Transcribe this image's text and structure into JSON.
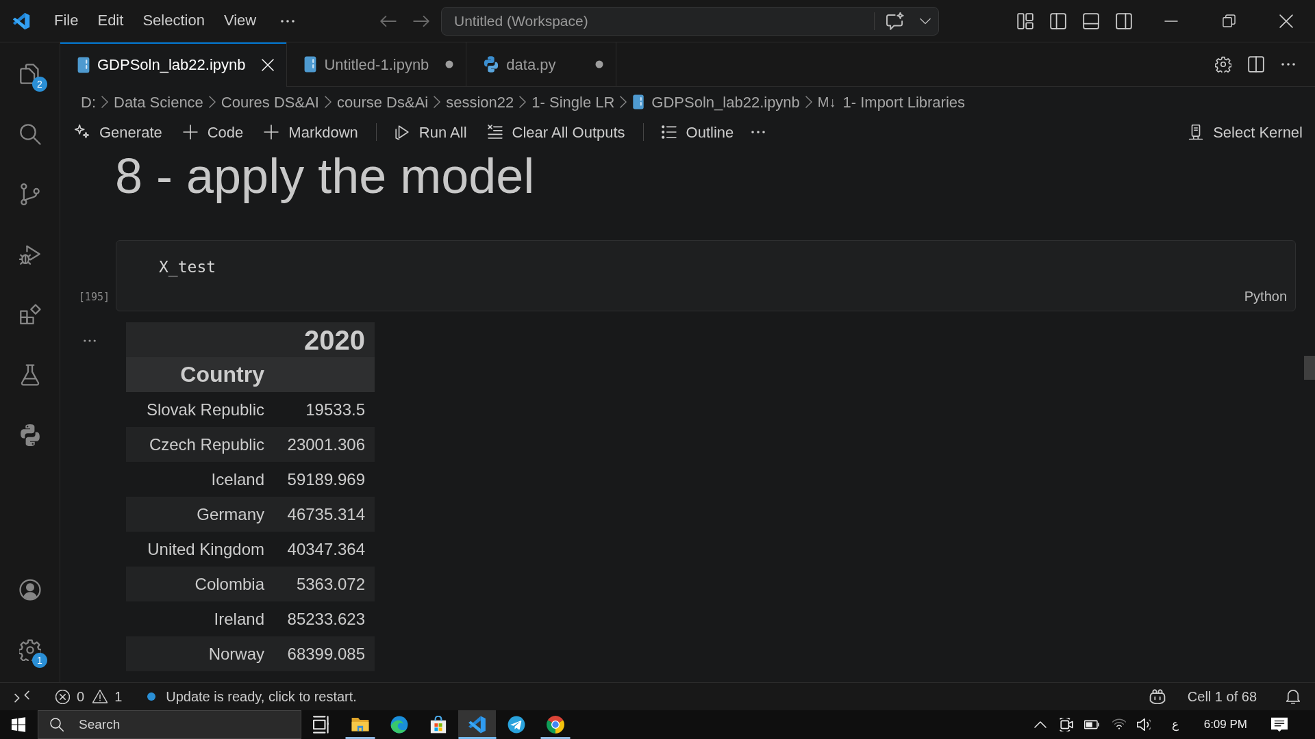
{
  "title_bar": {
    "menu": [
      "File",
      "Edit",
      "Selection",
      "View"
    ],
    "command_center": "Untitled (Workspace)"
  },
  "activity_bar": {
    "items": [
      {
        "kind": "explorer",
        "badge": "2",
        "selected": false
      },
      {
        "kind": "search",
        "selected": false
      },
      {
        "kind": "source-control",
        "selected": false
      },
      {
        "kind": "run-debug",
        "selected": false
      },
      {
        "kind": "extensions",
        "selected": false
      },
      {
        "kind": "testing",
        "selected": false
      },
      {
        "kind": "python",
        "selected": false
      }
    ],
    "bottom_items": [
      {
        "kind": "account",
        "selected": false
      },
      {
        "kind": "manage",
        "badge": "1",
        "selected": false
      }
    ]
  },
  "tabs": [
    {
      "kind": "notebook",
      "label": "GDPSoln_lab22.ipynb",
      "selected": true,
      "dirty": false
    },
    {
      "kind": "notebook",
      "label": "Untitled-1.ipynb",
      "selected": false,
      "dirty": true
    },
    {
      "kind": "python",
      "label": "data.py",
      "selected": false,
      "dirty": true
    }
  ],
  "breadcrumb": [
    {
      "kind": "folder",
      "label": "D:"
    },
    {
      "kind": "folder",
      "label": "Data Science"
    },
    {
      "kind": "folder",
      "label": "Coures DS&AI"
    },
    {
      "kind": "folder",
      "label": "course Ds&Ai"
    },
    {
      "kind": "folder",
      "label": "session22"
    },
    {
      "kind": "folder",
      "label": "1- Single LR"
    },
    {
      "kind": "notebook",
      "label": "GDPSoln_lab22.ipynb"
    },
    {
      "kind": "markdown",
      "icon": "M↓",
      "label": "1- Import Libraries"
    }
  ],
  "notebook_toolbar": {
    "items": [
      {
        "kind": "generate",
        "label": "Generate"
      },
      {
        "kind": "add",
        "label": "Code"
      },
      {
        "kind": "add",
        "label": "Markdown"
      },
      {
        "kind": "separator"
      },
      {
        "kind": "run",
        "label": "Run All"
      },
      {
        "kind": "clear",
        "label": "Clear All Outputs"
      },
      {
        "kind": "separator"
      },
      {
        "kind": "outline",
        "label": "Outline"
      },
      {
        "kind": "more"
      }
    ],
    "kernel": "Select Kernel"
  },
  "notebook": {
    "heading": "8 - apply the model",
    "cells": [
      {
        "kind": "code",
        "execution_count": "[195]",
        "source": "X_test",
        "language": "Python",
        "output": {
          "columns": [
            "2020"
          ],
          "index_name": "Country",
          "rows": [
            {
              "index": "Slovak Republic",
              "values": [
                "19533.5"
              ]
            },
            {
              "index": "Czech Republic",
              "values": [
                "23001.306"
              ]
            },
            {
              "index": "Iceland",
              "values": [
                "59189.969"
              ]
            },
            {
              "index": "Germany",
              "values": [
                "46735.314"
              ]
            },
            {
              "index": "United Kingdom",
              "values": [
                "40347.364"
              ]
            },
            {
              "index": "Colombia",
              "values": [
                "5363.072"
              ]
            },
            {
              "index": "Ireland",
              "values": [
                "85233.623"
              ]
            },
            {
              "index": "Norway",
              "values": [
                "68399.085"
              ]
            }
          ]
        }
      }
    ]
  },
  "status_bar": {
    "errors": "0",
    "warnings": "1",
    "message": "Update is ready, click to restart.",
    "cell_position": "Cell 1 of 68"
  },
  "taskbar": {
    "search_placeholder": "Search",
    "apps": [
      {
        "kind": "task-view",
        "selected": false,
        "running": false
      },
      {
        "kind": "file-explorer",
        "selected": false,
        "running": true
      },
      {
        "kind": "edge",
        "selected": false,
        "running": false
      },
      {
        "kind": "store",
        "selected": false,
        "running": false
      },
      {
        "kind": "vscode",
        "selected": true,
        "running": true
      },
      {
        "kind": "telegram",
        "selected": false,
        "running": false
      },
      {
        "kind": "chrome",
        "selected": false,
        "running": true
      }
    ],
    "input_language": "ع",
    "clock": "6:09 PM"
  }
}
